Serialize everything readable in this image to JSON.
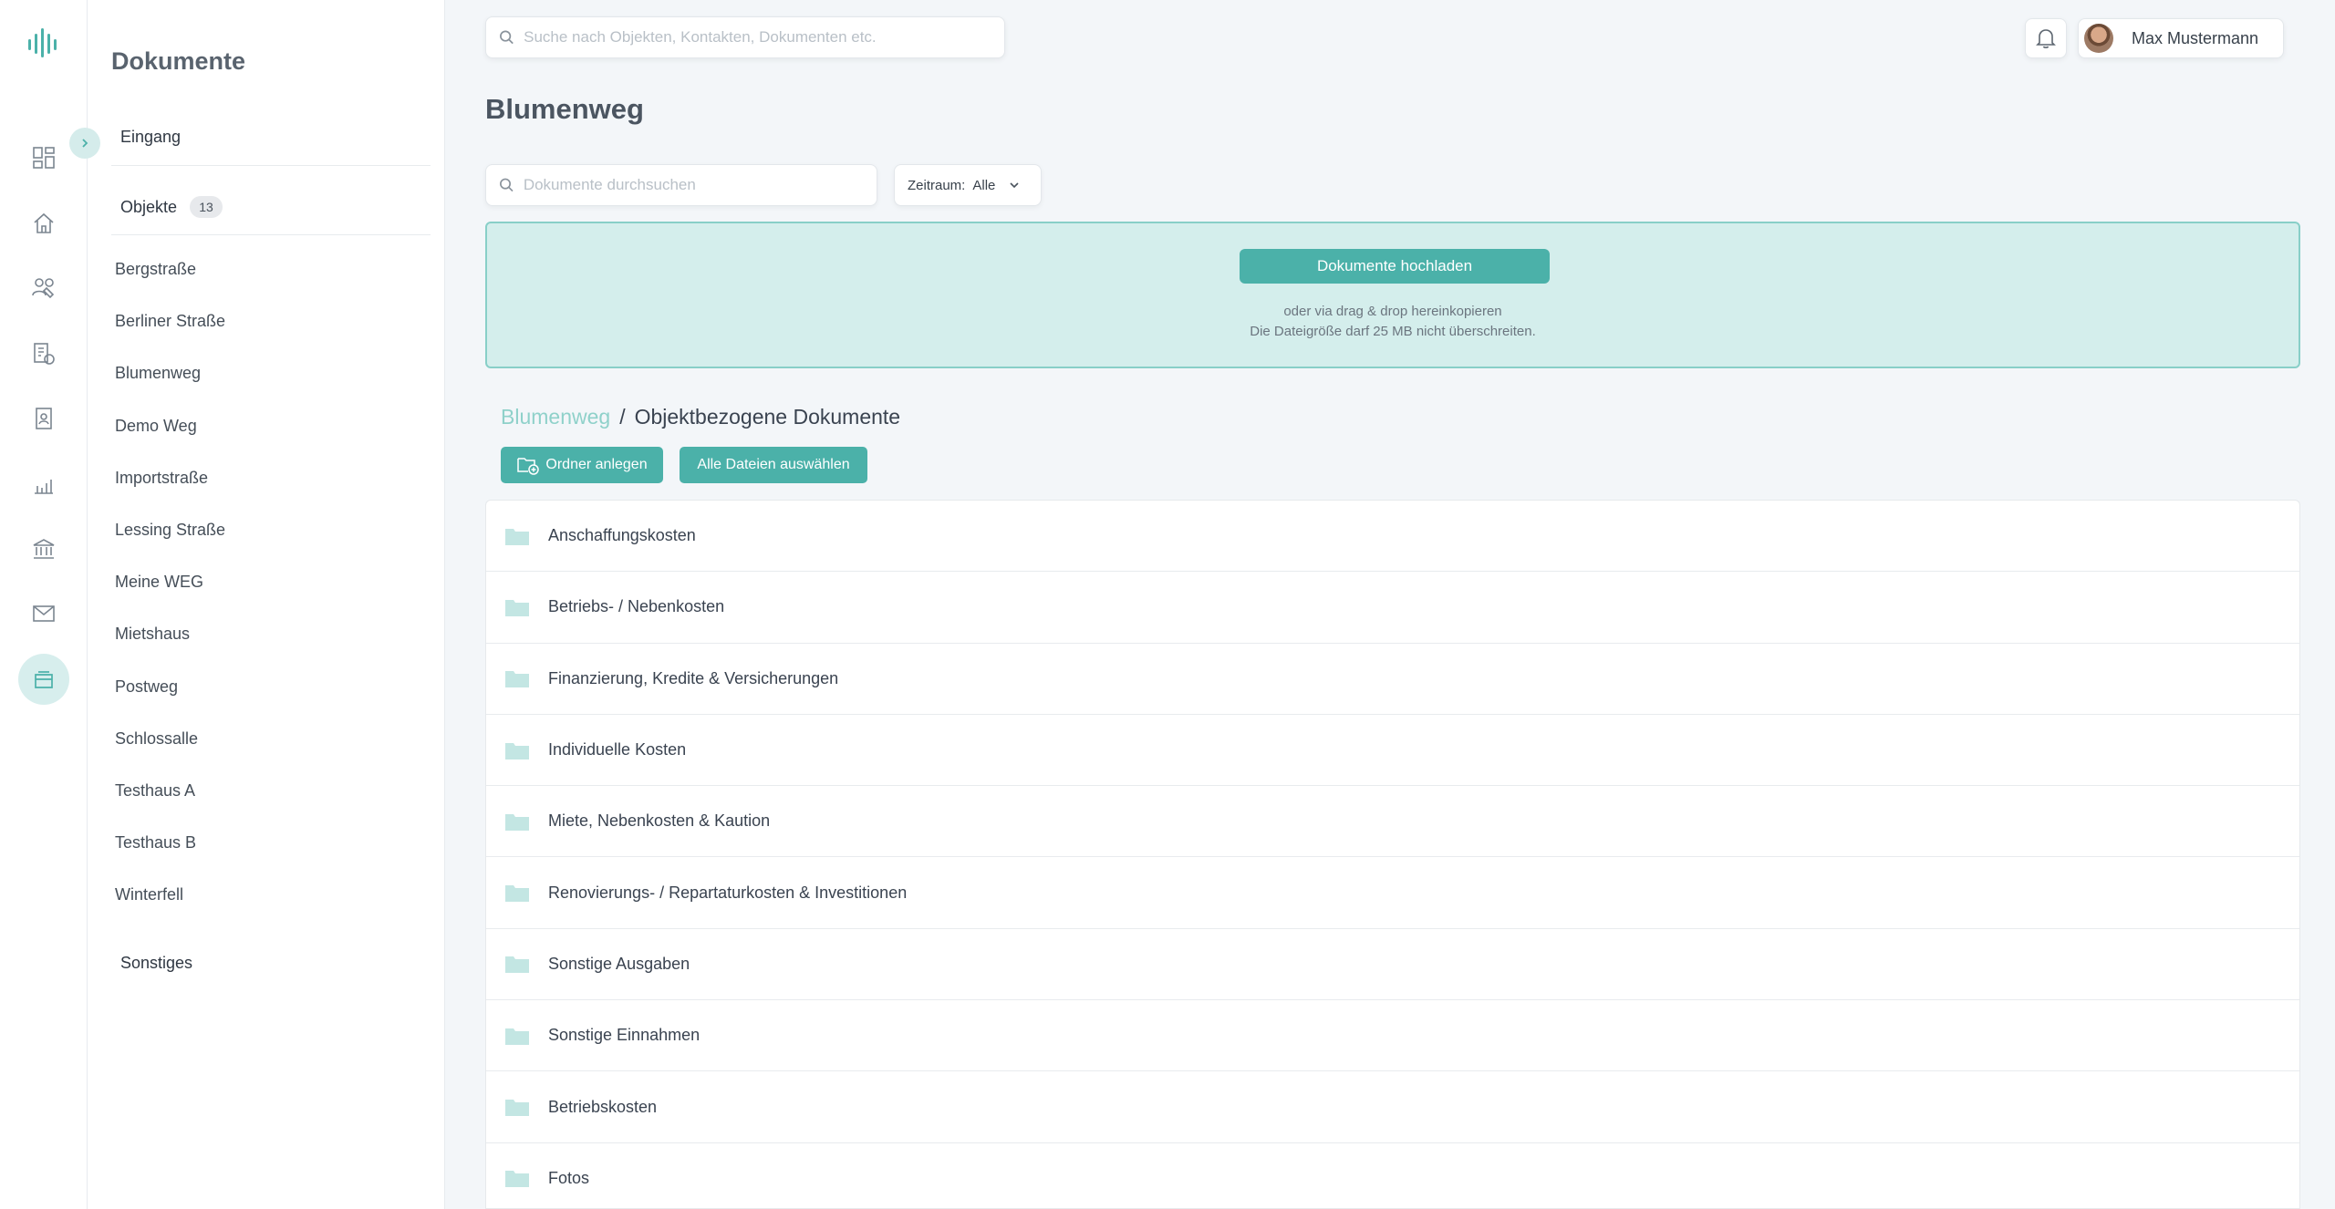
{
  "rail": {
    "items": [
      {
        "icon": "dashboard-icon"
      },
      {
        "icon": "home-icon"
      },
      {
        "icon": "contacts-icon"
      },
      {
        "icon": "billing-icon"
      },
      {
        "icon": "tenant-icon"
      },
      {
        "icon": "statistics-icon"
      },
      {
        "icon": "bank-icon"
      },
      {
        "icon": "mail-icon"
      },
      {
        "icon": "documents-icon",
        "active": true
      }
    ],
    "accent": "#4bb1a9"
  },
  "sidebar": {
    "title": "Dokumente",
    "inbox_label": "Eingang",
    "objects_label": "Objekte",
    "objects_count": "13",
    "objects": [
      "Bergstraße",
      "Berliner Straße",
      "Blumenweg",
      "Demo Weg",
      "Importstraße",
      "Lessing Straße",
      "Meine WEG",
      "Mietshaus",
      "Postweg",
      "Schlossalle",
      "Testhaus A",
      "Testhaus B",
      "Winterfell"
    ],
    "other_label": "Sonstiges"
  },
  "topbar": {
    "search_placeholder": "Suche nach Objekten, Kontakten, Dokumenten etc.",
    "user_name": "Max Mustermann"
  },
  "main": {
    "title": "Blumenweg",
    "doc_search_placeholder": "Dokumente durchsuchen",
    "period_label": "Zeitraum:",
    "period_value": "Alle",
    "upload": {
      "button_label": "Dokumente hochladen",
      "hint_line1": "oder via drag & drop hereinkopieren",
      "hint_line2": "Die Dateigröße darf 25 MB nicht überschreiten."
    },
    "breadcrumb": {
      "parent": "Blumenweg",
      "separator": "/",
      "current": "Objektbezogene Dokumente"
    },
    "actions": {
      "new_folder_label": "Ordner anlegen",
      "select_all_label": "Alle Dateien auswählen"
    },
    "folders": [
      "Anschaffungskosten",
      "Betriebs- / Nebenkosten",
      "Finanzierung, Kredite & Versicherungen",
      "Individuelle Kosten",
      "Miete, Nebenkosten & Kaution",
      "Renovierungs- / Repartaturkosten & Investitionen",
      "Sonstige Ausgaben",
      "Sonstige Einnahmen",
      "Betriebskosten",
      "Fotos"
    ]
  }
}
